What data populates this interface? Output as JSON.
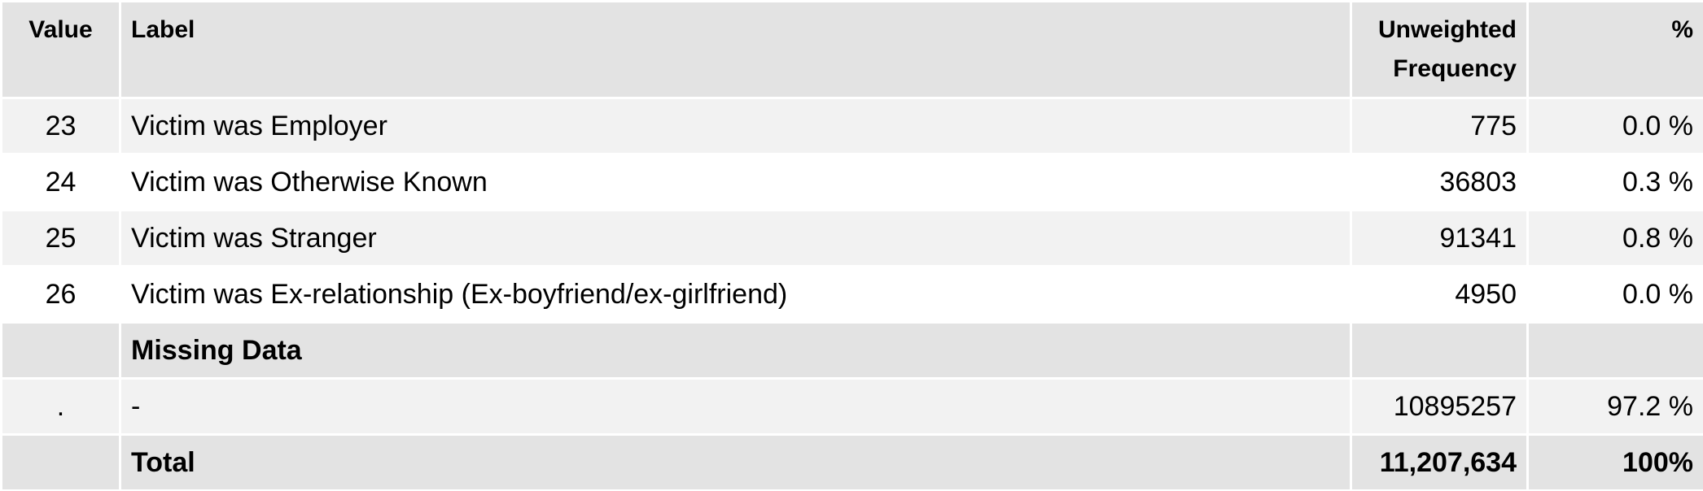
{
  "header": {
    "value": "Value",
    "label": "Label",
    "freq_line1": "Unweighted",
    "freq_line2": "Frequency",
    "pct": "%"
  },
  "rows": [
    {
      "value": "23",
      "label": "Victim was Employer",
      "freq": "775",
      "pct": "0.0 %"
    },
    {
      "value": "24",
      "label": "Victim was Otherwise Known",
      "freq": "36803",
      "pct": "0.3 %"
    },
    {
      "value": "25",
      "label": "Victim was Stranger",
      "freq": "91341",
      "pct": "0.8 %"
    },
    {
      "value": "26",
      "label": "Victim was Ex-relationship (Ex-boyfriend/ex-girlfriend)",
      "freq": "4950",
      "pct": "0.0 %"
    }
  ],
  "missing": {
    "section_label": "Missing Data",
    "rows": [
      {
        "value": ".",
        "label": "-",
        "freq": "10895257",
        "pct": "97.2 %"
      }
    ]
  },
  "total": {
    "label": "Total",
    "freq": "11,207,634",
    "pct": "100%"
  }
}
